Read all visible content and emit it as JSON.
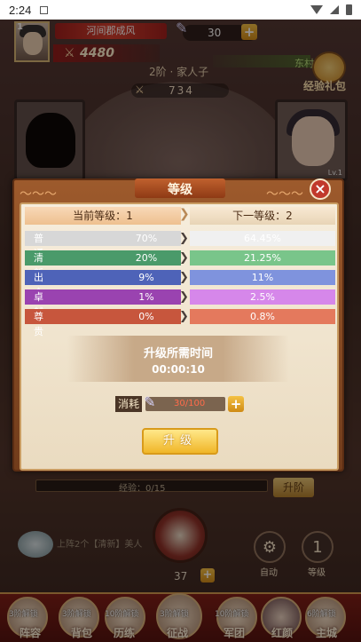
{
  "status_bar": {
    "time": "2:24"
  },
  "hud": {
    "player_level": "1",
    "player_name": "河间郡成风",
    "power": "4480",
    "resource": "30",
    "rank": "2阶 · 家人子",
    "score": "734",
    "east_label": "东村",
    "gift_label": "经验礼包"
  },
  "dialog": {
    "title": "等级",
    "current_level": "当前等级：1",
    "next_level": "下一等级：2",
    "rows": [
      {
        "name": "普通",
        "current": "70%",
        "next": "64.45%",
        "color_l": "#d7d7d7",
        "color_r": "#f0f0f0"
      },
      {
        "name": "清新",
        "current": "20%",
        "next": "21.25%",
        "color_l": "#4a9a6a",
        "color_r": "#79c58a"
      },
      {
        "name": "出众",
        "current": "9%",
        "next": "11%",
        "color_l": "#4e63b8",
        "color_r": "#7f93dd"
      },
      {
        "name": "卓越",
        "current": "1%",
        "next": "2.5%",
        "color_l": "#9a43b0",
        "color_r": "#d687ea"
      },
      {
        "name": "尊贵",
        "current": "0%",
        "next": "0.8%",
        "color_l": "#c7563d",
        "color_r": "#e4795d"
      }
    ],
    "time_title": "升级所需时间",
    "time_value": "00:00:10",
    "cost_label": "消耗",
    "cost_value": "30/100",
    "upgrade_label": "升级"
  },
  "bottom": {
    "exp_label": "经验：0/15",
    "exp_button": "升阶",
    "notice": "上阵2个【清新】美人",
    "count": "37",
    "auto_label": "自动",
    "level_label": "等级",
    "level_number": "1"
  },
  "dock": [
    {
      "tag": "3阶解锁",
      "label": "阵容"
    },
    {
      "tag": "3阶解锁",
      "label": "背包"
    },
    {
      "tag": "10阶解锁",
      "label": "历练"
    },
    {
      "tag": "3阶解锁",
      "label": "征战"
    },
    {
      "tag": "10阶解锁",
      "label": "军团"
    },
    {
      "tag": "",
      "label": "红颜"
    },
    {
      "tag": "6阶解锁",
      "label": "主城"
    }
  ]
}
